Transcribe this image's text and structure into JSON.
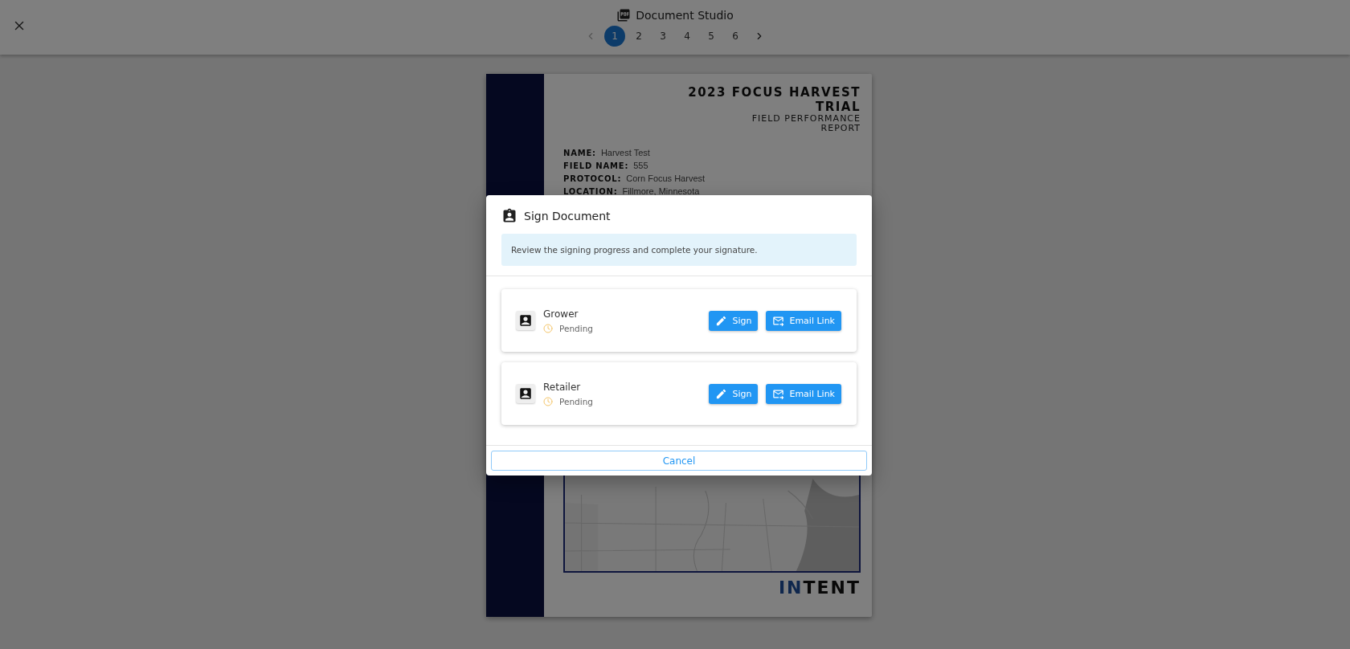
{
  "app_bar": {
    "title": "Document Studio",
    "prev": {
      "disabled": true
    },
    "next": {
      "disabled": false
    },
    "pages": [
      {
        "label": "1",
        "selected": true
      },
      {
        "label": "2",
        "selected": false
      },
      {
        "label": "3",
        "selected": false
      },
      {
        "label": "4",
        "selected": false
      },
      {
        "label": "5",
        "selected": false
      },
      {
        "label": "6",
        "selected": false
      }
    ]
  },
  "document": {
    "title_lines": [
      "2023 FOCUS HARVEST",
      "TRIAL"
    ],
    "subtitle_lines": [
      "FIELD PERFORMANCE",
      "REPORT"
    ],
    "fields": [
      {
        "label": "NAME:",
        "value": "Harvest Test"
      },
      {
        "label": "FIELD NAME:",
        "value": "555"
      },
      {
        "label": "PROTOCOL:",
        "value": "Corn Focus Harvest"
      },
      {
        "label": "LOCATION:",
        "value": "Fillmore, Minnesota"
      }
    ],
    "logo": {
      "accent": "IN",
      "rest": "TENT"
    }
  },
  "dialog": {
    "title": "Sign Document",
    "info": "Review the signing progress and complete your signature.",
    "signers": [
      {
        "role": "Grower",
        "status": "Pending",
        "sign": "Sign",
        "email": "Email Link"
      },
      {
        "role": "Retailer",
        "status": "Pending",
        "sign": "Sign",
        "email": "Email Link"
      }
    ],
    "cancel": "Cancel"
  }
}
